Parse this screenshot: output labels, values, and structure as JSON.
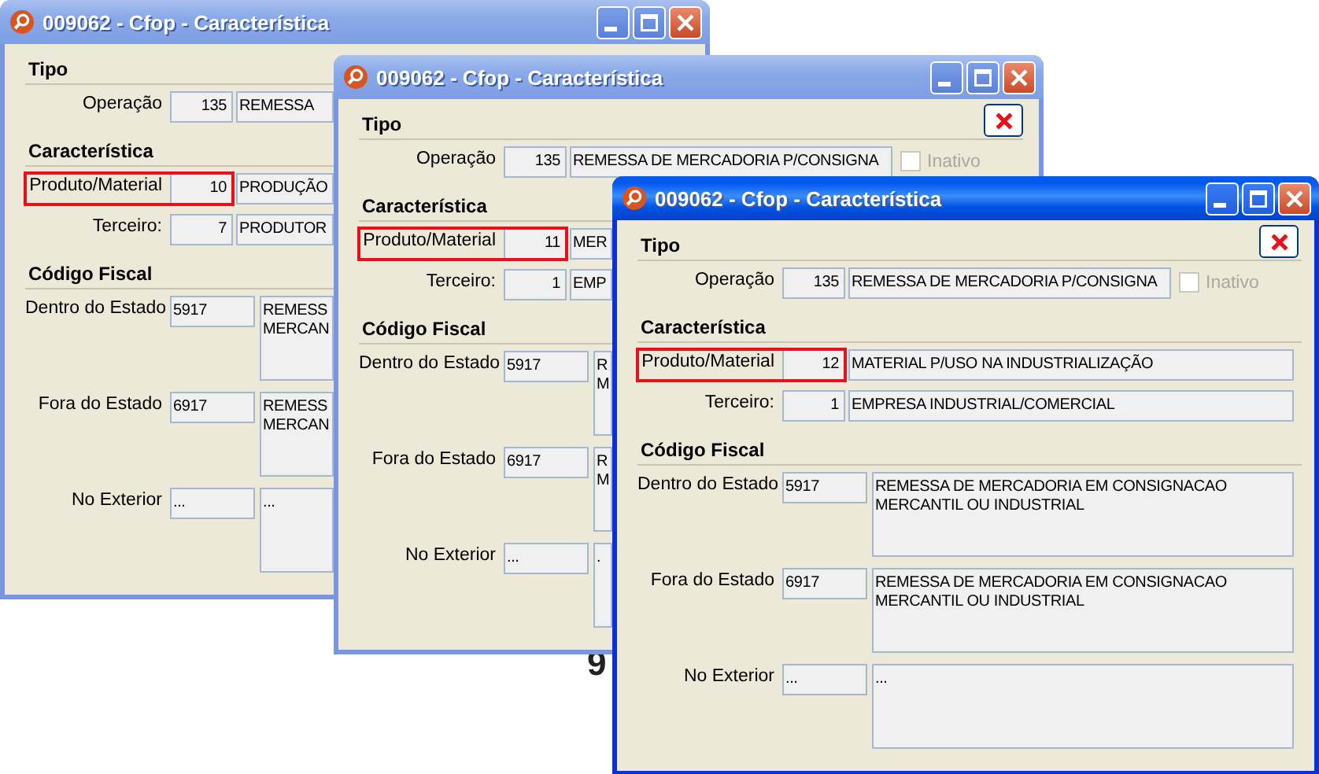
{
  "background_text": "9",
  "windows": [
    {
      "title": "009062 - Cfop - Característica",
      "active": false,
      "sections": [
        {
          "heading": "Tipo",
          "rows": [
            {
              "kind": "short",
              "label": "Operação",
              "code": "135",
              "description": "REMESSA",
              "highlighted": false
            }
          ]
        },
        {
          "heading": "Característica",
          "rows": [
            {
              "kind": "short",
              "label": "Produto/Material",
              "code": "10",
              "description": "PRODUÇÃO",
              "highlighted": true
            },
            {
              "kind": "short",
              "label": "Terceiro:",
              "code": "7",
              "description": "PRODUTOR",
              "highlighted": false
            }
          ]
        },
        {
          "heading": "Código Fiscal",
          "rows": [
            {
              "kind": "memo",
              "label": "Dentro do Estado",
              "code": "5917",
              "description": "REMESS\nMERCAN",
              "highlighted": false
            },
            {
              "kind": "memo",
              "label": "Fora do Estado",
              "code": "6917",
              "description": "REMESS\nMERCAN",
              "highlighted": false
            },
            {
              "kind": "memo",
              "label": "No Exterior",
              "code": "...",
              "description": "...",
              "highlighted": false
            }
          ]
        }
      ]
    },
    {
      "title": "009062 - Cfop - Característica",
      "active": false,
      "close_button": true,
      "sections": [
        {
          "heading": "Tipo",
          "rows": [
            {
              "kind": "short",
              "label": "Operação",
              "code": "135",
              "description": "REMESSA DE MERCADORIA P/CONSIGNA",
              "highlighted": false,
              "checkbox": {
                "label": "Inativo",
                "checked": false,
                "disabled": true
              }
            }
          ]
        },
        {
          "heading": "Característica",
          "rows": [
            {
              "kind": "short",
              "label": "Produto/Material",
              "code": "11",
              "description": "MER",
              "highlighted": true
            },
            {
              "kind": "short",
              "label": "Terceiro:",
              "code": "1",
              "description": "EMP",
              "highlighted": false
            }
          ]
        },
        {
          "heading": "Código Fiscal",
          "rows": [
            {
              "kind": "memo",
              "label": "Dentro do Estado",
              "code": "5917",
              "description": "R\nM",
              "highlighted": false
            },
            {
              "kind": "memo",
              "label": "Fora do Estado",
              "code": "6917",
              "description": "R\nM",
              "highlighted": false
            },
            {
              "kind": "memo",
              "label": "No Exterior",
              "code": "...",
              "description": ".",
              "highlighted": false
            }
          ]
        }
      ]
    },
    {
      "title": "009062 - Cfop - Característica",
      "active": true,
      "close_button": true,
      "sections": [
        {
          "heading": "Tipo",
          "rows": [
            {
              "kind": "short",
              "label": "Operação",
              "code": "135",
              "description": "REMESSA DE MERCADORIA P/CONSIGNA",
              "highlighted": false,
              "checkbox": {
                "label": "Inativo",
                "checked": false,
                "disabled": true
              }
            }
          ]
        },
        {
          "heading": "Característica",
          "rows": [
            {
              "kind": "short",
              "label": "Produto/Material",
              "code": "12",
              "description": "MATERIAL P/USO NA INDUSTRIALIZAÇÃO",
              "highlighted": true
            },
            {
              "kind": "short",
              "label": "Terceiro:",
              "code": "1",
              "description": "EMPRESA INDUSTRIAL/COMERCIAL",
              "highlighted": false
            }
          ]
        },
        {
          "heading": "Código Fiscal",
          "rows": [
            {
              "kind": "memo",
              "label": "Dentro do Estado",
              "code": "5917",
              "description": "REMESSA DE MERCADORIA EM CONSIGNACAO\nMERCANTIL OU INDUSTRIAL",
              "highlighted": false
            },
            {
              "kind": "memo",
              "label": "Fora do Estado",
              "code": "6917",
              "description": "REMESSA DE MERCADORIA EM CONSIGNACAO\nMERCANTIL OU INDUSTRIAL",
              "highlighted": false
            },
            {
              "kind": "memo",
              "label": "No Exterior",
              "code": "...",
              "description": "...",
              "highlighted": false
            }
          ]
        }
      ]
    }
  ]
}
